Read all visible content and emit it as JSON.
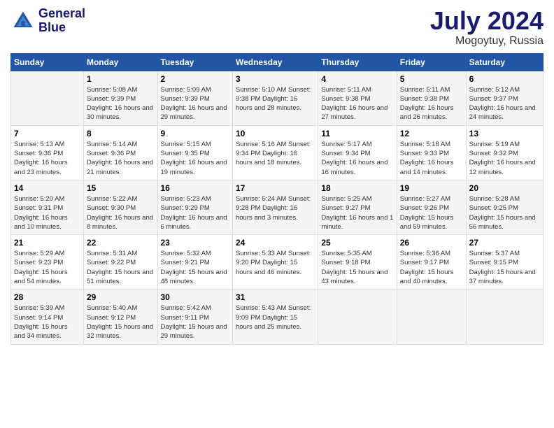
{
  "logo": {
    "text_line1": "General",
    "text_line2": "Blue"
  },
  "title": {
    "month_year": "July 2024",
    "location": "Mogoytuy, Russia"
  },
  "headers": [
    "Sunday",
    "Monday",
    "Tuesday",
    "Wednesday",
    "Thursday",
    "Friday",
    "Saturday"
  ],
  "weeks": [
    [
      {
        "day": "",
        "info": ""
      },
      {
        "day": "1",
        "info": "Sunrise: 5:08 AM\nSunset: 9:39 PM\nDaylight: 16 hours\nand 30 minutes."
      },
      {
        "day": "2",
        "info": "Sunrise: 5:09 AM\nSunset: 9:39 PM\nDaylight: 16 hours\nand 29 minutes."
      },
      {
        "day": "3",
        "info": "Sunrise: 5:10 AM\nSunset: 9:38 PM\nDaylight: 16 hours\nand 28 minutes."
      },
      {
        "day": "4",
        "info": "Sunrise: 5:11 AM\nSunset: 9:38 PM\nDaylight: 16 hours\nand 27 minutes."
      },
      {
        "day": "5",
        "info": "Sunrise: 5:11 AM\nSunset: 9:38 PM\nDaylight: 16 hours\nand 26 minutes."
      },
      {
        "day": "6",
        "info": "Sunrise: 5:12 AM\nSunset: 9:37 PM\nDaylight: 16 hours\nand 24 minutes."
      }
    ],
    [
      {
        "day": "7",
        "info": "Sunrise: 5:13 AM\nSunset: 9:36 PM\nDaylight: 16 hours\nand 23 minutes."
      },
      {
        "day": "8",
        "info": "Sunrise: 5:14 AM\nSunset: 9:36 PM\nDaylight: 16 hours\nand 21 minutes."
      },
      {
        "day": "9",
        "info": "Sunrise: 5:15 AM\nSunset: 9:35 PM\nDaylight: 16 hours\nand 19 minutes."
      },
      {
        "day": "10",
        "info": "Sunrise: 5:16 AM\nSunset: 9:34 PM\nDaylight: 16 hours\nand 18 minutes."
      },
      {
        "day": "11",
        "info": "Sunrise: 5:17 AM\nSunset: 9:34 PM\nDaylight: 16 hours\nand 16 minutes."
      },
      {
        "day": "12",
        "info": "Sunrise: 5:18 AM\nSunset: 9:33 PM\nDaylight: 16 hours\nand 14 minutes."
      },
      {
        "day": "13",
        "info": "Sunrise: 5:19 AM\nSunset: 9:32 PM\nDaylight: 16 hours\nand 12 minutes."
      }
    ],
    [
      {
        "day": "14",
        "info": "Sunrise: 5:20 AM\nSunset: 9:31 PM\nDaylight: 16 hours\nand 10 minutes."
      },
      {
        "day": "15",
        "info": "Sunrise: 5:22 AM\nSunset: 9:30 PM\nDaylight: 16 hours\nand 8 minutes."
      },
      {
        "day": "16",
        "info": "Sunrise: 5:23 AM\nSunset: 9:29 PM\nDaylight: 16 hours\nand 6 minutes."
      },
      {
        "day": "17",
        "info": "Sunrise: 5:24 AM\nSunset: 9:28 PM\nDaylight: 16 hours\nand 3 minutes."
      },
      {
        "day": "18",
        "info": "Sunrise: 5:25 AM\nSunset: 9:27 PM\nDaylight: 16 hours\nand 1 minute."
      },
      {
        "day": "19",
        "info": "Sunrise: 5:27 AM\nSunset: 9:26 PM\nDaylight: 15 hours\nand 59 minutes."
      },
      {
        "day": "20",
        "info": "Sunrise: 5:28 AM\nSunset: 9:25 PM\nDaylight: 15 hours\nand 56 minutes."
      }
    ],
    [
      {
        "day": "21",
        "info": "Sunrise: 5:29 AM\nSunset: 9:23 PM\nDaylight: 15 hours\nand 54 minutes."
      },
      {
        "day": "22",
        "info": "Sunrise: 5:31 AM\nSunset: 9:22 PM\nDaylight: 15 hours\nand 51 minutes."
      },
      {
        "day": "23",
        "info": "Sunrise: 5:32 AM\nSunset: 9:21 PM\nDaylight: 15 hours\nand 48 minutes."
      },
      {
        "day": "24",
        "info": "Sunrise: 5:33 AM\nSunset: 9:20 PM\nDaylight: 15 hours\nand 46 minutes."
      },
      {
        "day": "25",
        "info": "Sunrise: 5:35 AM\nSunset: 9:18 PM\nDaylight: 15 hours\nand 43 minutes."
      },
      {
        "day": "26",
        "info": "Sunrise: 5:36 AM\nSunset: 9:17 PM\nDaylight: 15 hours\nand 40 minutes."
      },
      {
        "day": "27",
        "info": "Sunrise: 5:37 AM\nSunset: 9:15 PM\nDaylight: 15 hours\nand 37 minutes."
      }
    ],
    [
      {
        "day": "28",
        "info": "Sunrise: 5:39 AM\nSunset: 9:14 PM\nDaylight: 15 hours\nand 34 minutes."
      },
      {
        "day": "29",
        "info": "Sunrise: 5:40 AM\nSunset: 9:12 PM\nDaylight: 15 hours\nand 32 minutes."
      },
      {
        "day": "30",
        "info": "Sunrise: 5:42 AM\nSunset: 9:11 PM\nDaylight: 15 hours\nand 29 minutes."
      },
      {
        "day": "31",
        "info": "Sunrise: 5:43 AM\nSunset: 9:09 PM\nDaylight: 15 hours\nand 25 minutes."
      },
      {
        "day": "",
        "info": ""
      },
      {
        "day": "",
        "info": ""
      },
      {
        "day": "",
        "info": ""
      }
    ]
  ]
}
